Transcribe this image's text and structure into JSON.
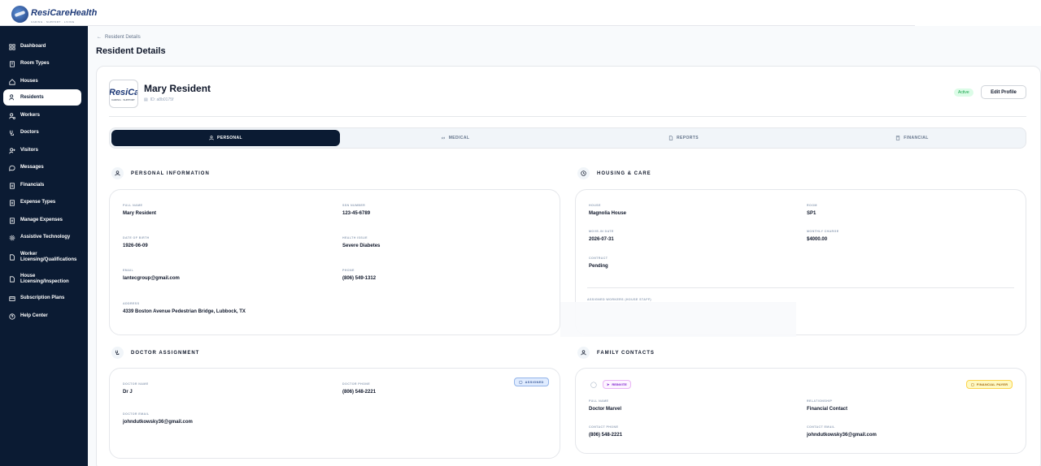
{
  "app": {
    "logo_text": "ResiCareHealth",
    "logo_sub": "CARING · SUPPORT · LIVING"
  },
  "sidebar": {
    "items": [
      {
        "label": "Dashboard",
        "icon": "grid-icon"
      },
      {
        "label": "Room Types",
        "icon": "building-icon"
      },
      {
        "label": "Houses",
        "icon": "home-icon"
      },
      {
        "label": "Residents",
        "icon": "users-icon",
        "active": true
      },
      {
        "label": "Workers",
        "icon": "user-gear-icon"
      },
      {
        "label": "Doctors",
        "icon": "stethoscope-icon"
      },
      {
        "label": "Visitors",
        "icon": "user-plus-icon"
      },
      {
        "label": "Messages",
        "icon": "chat-icon"
      },
      {
        "label": "Financials",
        "icon": "receipt-icon"
      },
      {
        "label": "Expense Types",
        "icon": "receipt-icon"
      },
      {
        "label": "Manage Expenses",
        "icon": "receipt-icon"
      },
      {
        "label": "Assistive Technology",
        "icon": "gear-icon"
      },
      {
        "label": "Worker Licensing/Qualifications",
        "icon": "document-icon"
      },
      {
        "label": "House Licensing/Inspection",
        "icon": "document-icon"
      },
      {
        "label": "Subscription Plans",
        "icon": "card-icon"
      },
      {
        "label": "Help Center",
        "icon": "help-icon"
      }
    ]
  },
  "breadcrumb": {
    "back_label": "Resident Details"
  },
  "page_title": "Resident Details",
  "resident": {
    "avatar_text": "ResiCar",
    "avatar_sub": "CARING · SUPPORT",
    "name": "Mary Resident",
    "id_label": "ID: a8b0175f",
    "status": "Active",
    "edit_label": "Edit Profile"
  },
  "tabs": [
    {
      "label": "PERSONAL",
      "icon": "user-icon",
      "active": true
    },
    {
      "label": "MEDICAL",
      "icon": "link-icon"
    },
    {
      "label": "REPORTS",
      "icon": "document-icon"
    },
    {
      "label": "FINANCIAL",
      "icon": "calculator-icon"
    }
  ],
  "personal_info": {
    "title": "PERSONAL INFORMATION",
    "full_name_label": "FULL NAME",
    "full_name": "Mary Resident",
    "ssn_label": "SSN NUMBER",
    "ssn": "123-45-6789",
    "dob_label": "DATE OF BIRTH",
    "dob": "1926-06-09",
    "health_label": "HEALTH ISSUE",
    "health": "Severe Diabetes",
    "email_label": "EMAIL",
    "email": "lantecgroup@gmail.com",
    "phone_label": "PHONE",
    "phone": "(806) 549-1312",
    "address_label": "ADDRESS",
    "address": "4339 Boston Avenue Pedestrian Bridge, Lubbock, TX"
  },
  "housing": {
    "title": "HOUSING & CARE",
    "house_label": "HOUSE",
    "house": "Magnolia House",
    "room_label": "ROOM",
    "room": "SP1",
    "move_in_label": "MOVE-IN DATE",
    "move_in": "2026-07-31",
    "monthly_label": "MONTHLY CHARGE",
    "monthly": "$4000.00",
    "contract_label": "CONTRACT",
    "contract": "Pending",
    "workers_label": "ASSIGNED WORKERS (HOUSE STAFF)"
  },
  "doctor": {
    "title": "DOCTOR ASSIGNMENT",
    "status": "ASSIGNED",
    "name_label": "DOCTOR NAME",
    "name": "Dr J",
    "phone_label": "DOCTOR PHONE",
    "phone": "(806) 548-2221",
    "email_label": "DOCTOR EMAIL",
    "email": "johndutkowsky36@gmail.com"
  },
  "family": {
    "title": "FAMILY CONTACTS",
    "reinvite_label": "REINVITE",
    "payer_label": "FINANCIAL PAYER",
    "full_name_label": "FULL NAME",
    "full_name": "Doctor Marvel",
    "relationship_label": "RELATIONSHIP",
    "relationship": "Financial Contact",
    "phone_label": "CONTACT PHONE",
    "phone": "(806) 548-2221",
    "email_label": "CONTACT EMAIL",
    "email": "johndutkowsky36@gmail.com"
  },
  "colors": {
    "sidebar_bg": "#0b1b33",
    "active_tab_bg": "#0b1b33",
    "status_active": "#16a34a",
    "assigned_badge": "#3b5b9a",
    "reinvite_badge": "#7e22ce",
    "payer_badge": "#a16207"
  }
}
